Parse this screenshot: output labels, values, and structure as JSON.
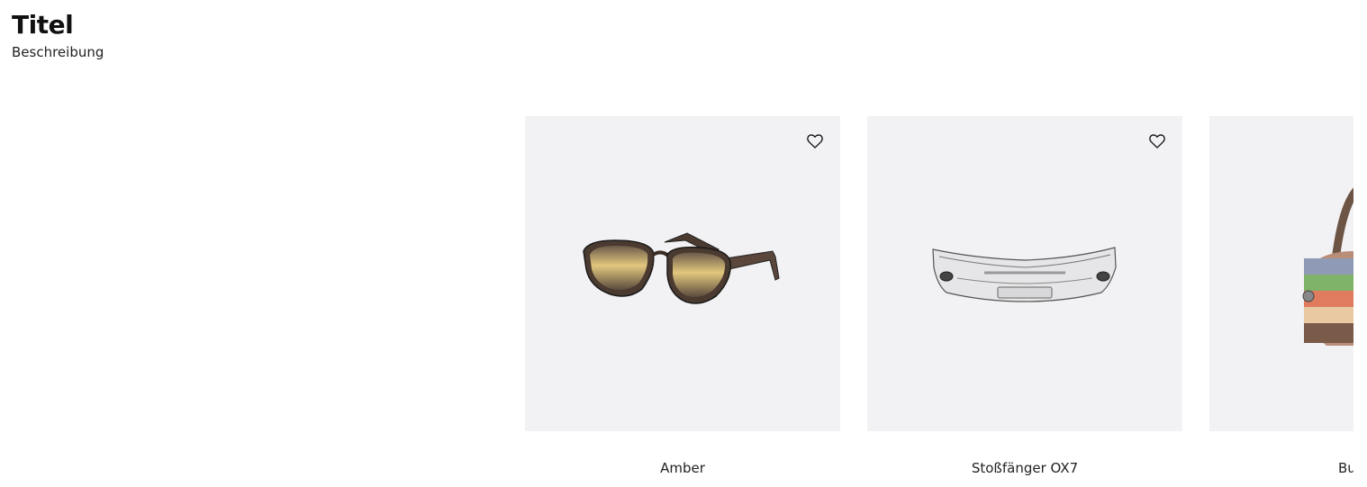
{
  "header": {
    "title": "Titel",
    "description": "Beschreibung"
  },
  "products": [
    {
      "name": "Amber",
      "image": "sunglasses",
      "favorite_icon": "heart-outline-icon"
    },
    {
      "name": "Stoßfänger OX7",
      "image": "car-bumper",
      "favorite_icon": "heart-outline-icon"
    },
    {
      "name": "Bu",
      "image": "striped-handbag",
      "favorite_icon": "heart-outline-icon"
    }
  ]
}
